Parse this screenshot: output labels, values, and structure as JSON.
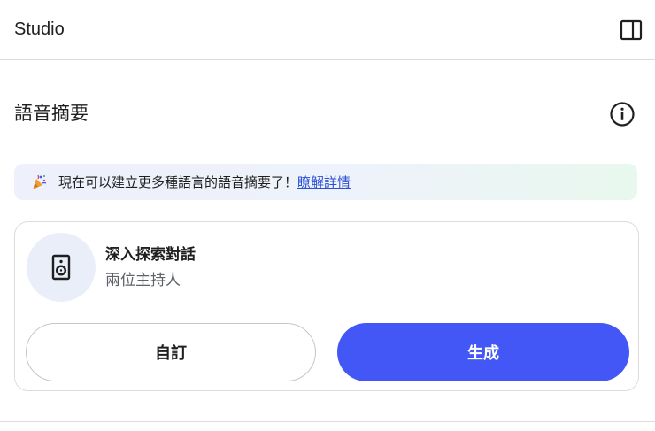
{
  "header": {
    "title": "Studio"
  },
  "audio_overview": {
    "title": "語音摘要",
    "banner": {
      "text": "現在可以建立更多種語言的語音摘要了！",
      "link_text": "瞭解詳情"
    },
    "card": {
      "title": "深入探索對話",
      "subtitle": "兩位主持人",
      "customize_label": "自訂",
      "generate_label": "生成"
    }
  },
  "colors": {
    "accent": "#4257f5",
    "link": "#2b50d6"
  },
  "icons": {
    "panel_toggle": "panel-toggle-icon",
    "info": "info-icon",
    "banner": "party-popper-icon",
    "card": "speaker-icon"
  }
}
